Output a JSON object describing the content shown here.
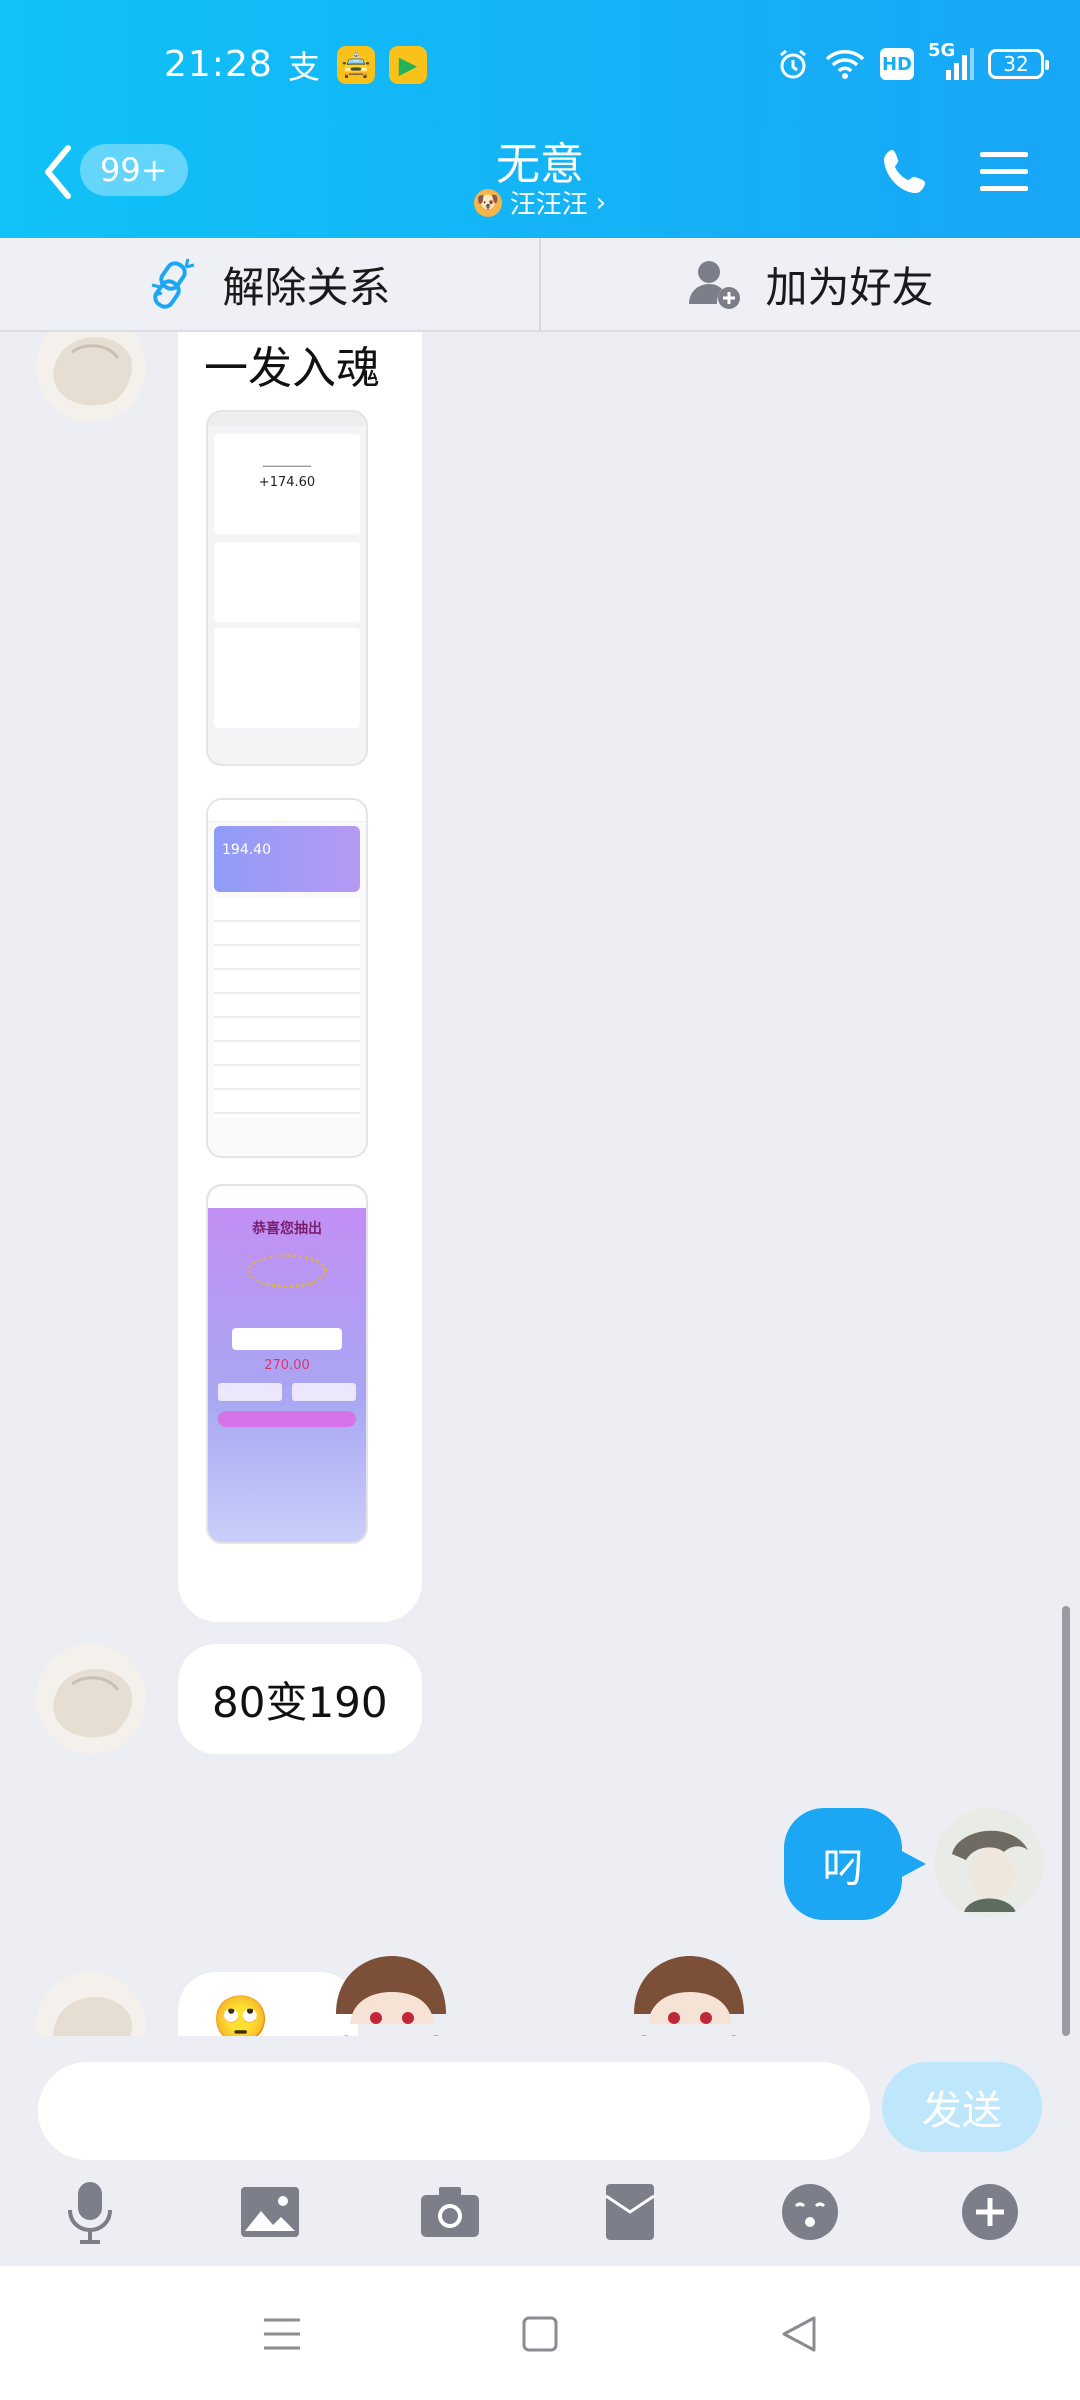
{
  "status_bar": {
    "time": "21:28",
    "app_icons": [
      "alipay-icon",
      "taxi-app-icon",
      "video-app-icon"
    ],
    "app_icon_text": {
      "pay": "支",
      "taxi": "🚖",
      "video": "▶"
    },
    "hd_label": "HD",
    "network_label": "5G",
    "battery_level": "32"
  },
  "header": {
    "unread_count": "99+",
    "title": "无意",
    "subtitle": "汪汪汪",
    "subtitle_chevron": "›",
    "background": "#14b4f7"
  },
  "actions": {
    "unlink_label": "解除关系",
    "add_friend_label": "加为好友"
  },
  "messages": [
    {
      "side": "left",
      "type": "text-with-images",
      "text": "一发入魂",
      "images": [
        {
          "kind": "transaction-detail-screenshot",
          "amount": "+174.60"
        },
        {
          "kind": "game-balance-screenshot",
          "amount": "194.40"
        },
        {
          "kind": "prize-screenshot",
          "heading": "恭喜您抽出",
          "amount": "270.00"
        }
      ]
    },
    {
      "side": "left",
      "type": "text",
      "text": "80变190"
    },
    {
      "side": "right",
      "type": "text",
      "text": "叼"
    },
    {
      "side": "left",
      "type": "emoji",
      "text": "🙄🙄"
    }
  ],
  "input": {
    "placeholder": "",
    "send_label": "发送"
  },
  "toolbar": [
    "microphone-icon",
    "image-icon",
    "camera-icon",
    "red-packet-icon",
    "emoji-icon",
    "plus-icon"
  ],
  "colors": {
    "accent": "#1ba7f3",
    "send_disabled": "#bfe7fb",
    "chat_background": "#eceef3"
  }
}
